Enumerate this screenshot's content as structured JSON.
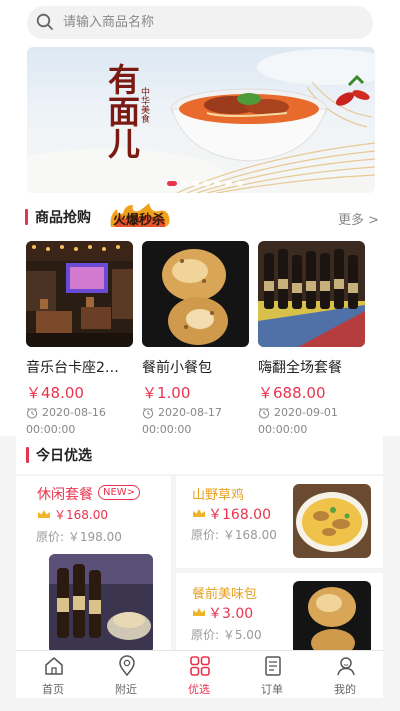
{
  "search": {
    "placeholder": "请输入商品名称"
  },
  "banner": {
    "calligraphy": "有面儿",
    "small_text": "中华美食",
    "dot_count": 7,
    "active_dot": 0
  },
  "flash_sale": {
    "title": "商品抢购",
    "badge": "火爆秒杀",
    "more": "更多 >",
    "items": [
      {
        "name": "音乐台卡座2…",
        "price": "￥48.00",
        "date": "2020-08-16",
        "time": "00:00:00"
      },
      {
        "name": "餐前小餐包",
        "price": "￥1.00",
        "date": "2020-08-17",
        "time": "00:00:00"
      },
      {
        "name": "嗨翻全场套餐",
        "price": "￥688.00",
        "date": "2020-09-01",
        "time": "00:00:00"
      }
    ]
  },
  "today": {
    "title": "今日优选",
    "left": {
      "name": "休闲套餐",
      "tag": "NEW>",
      "price": "￥168.00",
      "orig": "原价: ￥198.00"
    },
    "right": [
      {
        "name": "山野草鸡",
        "price": "￥168.00",
        "orig": "原价: ￥168.00"
      },
      {
        "name": "餐前美味包",
        "price": "￥3.00",
        "orig": "原价: ￥5.00"
      }
    ]
  },
  "tabs": [
    {
      "label": "首页",
      "icon": "home-icon",
      "active": false
    },
    {
      "label": "附近",
      "icon": "location-pin-icon",
      "active": false
    },
    {
      "label": "优选",
      "icon": "grid-icon",
      "active": true
    },
    {
      "label": "订单",
      "icon": "order-document-icon",
      "active": false
    },
    {
      "label": "我的",
      "icon": "user-profile-icon",
      "active": false
    }
  ],
  "colors": {
    "accent": "#e8344e",
    "gold": "#e6a020",
    "muted": "#888888"
  }
}
